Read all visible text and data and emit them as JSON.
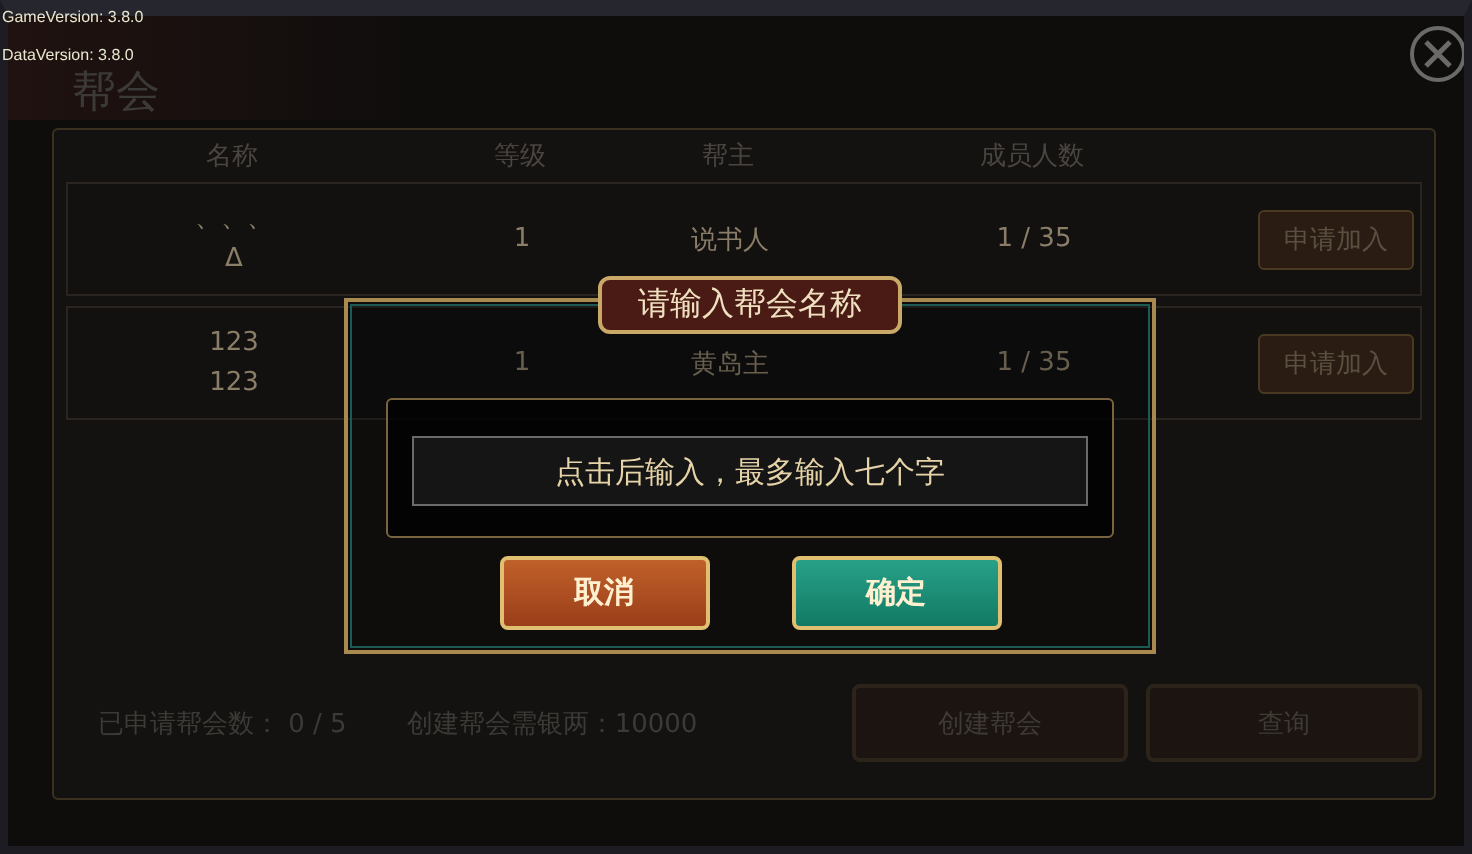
{
  "versions": [
    "GameVersion: 3.8.0",
    "DataVersion: 3.8.0"
  ],
  "window": {
    "title": "帮会"
  },
  "table": {
    "columns": [
      "名称",
      "等级",
      "帮主",
      "成员人数"
    ],
    "rows": [
      {
        "name": [
          "、、、",
          "Δ"
        ],
        "level": "1",
        "leader": "说书人",
        "members": "1 / 35",
        "button": "申请加入"
      },
      {
        "name": [
          "123",
          "123"
        ],
        "level": "1",
        "leader": "黄岛主",
        "members": "1 / 35",
        "button": "申请加入"
      }
    ]
  },
  "footer": {
    "applied": "已申请帮会数： 0 / 5",
    "cost": "创建帮会需银两：10000",
    "buttons": [
      "创建帮会",
      "查询"
    ]
  },
  "dialog": {
    "title": "请输入帮会名称",
    "placeholder": "点击后输入，最多输入七个字",
    "buttons": [
      {
        "label": "取消",
        "kind": "cancel"
      },
      {
        "label": "确定",
        "kind": "confirm"
      }
    ]
  }
}
